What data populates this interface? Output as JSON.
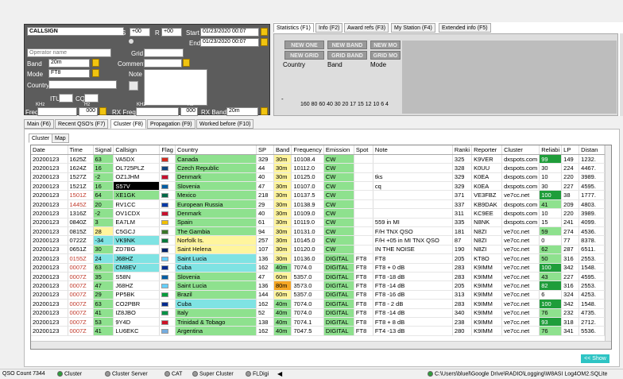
{
  "entry": {
    "callsign": "CALLSIGN",
    "s_label": "S",
    "s_value": "+00",
    "r_label": "R",
    "r_value": "+00",
    "start_label": "Start",
    "start_value": "01/23/2020 00:07",
    "end_label": "End",
    "end_value": "01/23/2020 00:07",
    "operator_placeholder": "Operator name",
    "grid_label": "Grid",
    "band_label": "Band",
    "band_value": "20m",
    "comment_label": "Comment",
    "mode_label": "Mode",
    "mode_value": "FT8",
    "note_label": "Note",
    "country_label": "Country",
    "itu_label": "ITU",
    "cq_label": "CQ",
    "freq_label": "Freq",
    "khz": "KHz",
    "hz": "Hz",
    "freq_value": "000",
    "rxfreq_label": "RX Freq",
    "rxfreq_value": "000",
    "rxband_label": "RX Band",
    "rxband_value": "20m"
  },
  "stats": {
    "tabs": [
      "Statistics (F1)",
      "Info (F2)",
      "Award refs (F3)",
      "My Station (F4)",
      "Extended info (F5)"
    ],
    "buttons": [
      "NEW ONE",
      "NEW BAND",
      "NEW MO",
      "NEW GRID",
      "GRID BAND",
      "GRID MO"
    ],
    "labels": [
      "Country",
      "Band",
      "Mode"
    ],
    "axis": "160 80 60 40 30 20 17 15 12 10 6 4",
    "dash": "-"
  },
  "main_tabs": [
    "Main (F6)",
    "Recent QSO's (F7)",
    "Cluster (F8)",
    "Propagation (F9)",
    "Worked before (F10)"
  ],
  "sub_tabs": [
    "Cluster",
    "Map"
  ],
  "columns": [
    "Date",
    "Time",
    "Signal",
    "Callsign",
    "Flag",
    "Country",
    "SP",
    "Band",
    "Frequency",
    "Emission",
    "Spot",
    "Note",
    "Ranki",
    "Reporter",
    "Cluster",
    "Reliabi",
    "LP",
    "Distan"
  ],
  "rows": [
    [
      "20200123",
      "1625Z",
      "63",
      "VA5DX",
      "ca",
      "Canada",
      "329",
      "30m",
      "10108.4",
      "CW",
      "",
      "",
      "325",
      "K9VER",
      "dxspots.com",
      "99",
      "149",
      "1232."
    ],
    [
      "20200123",
      "1624Z",
      "16",
      "OL725PLZ",
      "cz",
      "Czech Republic",
      "44",
      "30m",
      "10112.0",
      "CW",
      "",
      "",
      "328",
      "K0UU",
      "dxspots.com",
      "30",
      "224",
      "4467."
    ],
    [
      "20200123",
      "1527Z",
      "-2",
      "OZ1JHM",
      "dk",
      "Denmark",
      "40",
      "30m",
      "10125.0",
      "CW",
      "",
      "tks",
      "329",
      "K0EA",
      "dxspots.com",
      "10",
      "220",
      "3989."
    ],
    [
      "20200123",
      "1521Z",
      "16",
      "S57V",
      "si",
      "Slovenia",
      "47",
      "30m",
      "10107.0",
      "CW",
      "",
      "cq",
      "329",
      "K0EA",
      "dxspots.com",
      "30",
      "227",
      "4595."
    ],
    [
      "20200123",
      "1501Z",
      "64",
      "XE1GK",
      "mx",
      "Mexico",
      "218",
      "30m",
      "10137.5",
      "CW",
      "",
      "",
      "371",
      "VE3FBZ",
      "ve7cc.net",
      "100",
      "38",
      "1777."
    ],
    [
      "20200123",
      "1445Z",
      "20",
      "RV1CC",
      "ru",
      "European Russia",
      "29",
      "30m",
      "10138.9",
      "CW",
      "",
      "",
      "337",
      "KB9DAK",
      "dxspots.com",
      "41",
      "209",
      "4803."
    ],
    [
      "20200123",
      "1316Z",
      "-2",
      "OV1CDX",
      "dk",
      "Denmark",
      "40",
      "30m",
      "10109.0",
      "CW",
      "",
      "",
      "311",
      "KC9EE",
      "dxspots.com",
      "10",
      "220",
      "3989."
    ],
    [
      "20200123",
      "0840Z",
      "3",
      "EA7LM",
      "es",
      "Spain",
      "61",
      "30m",
      "10119.0",
      "CW",
      "",
      "559 in MI",
      "335",
      "N8NK",
      "dxspots.com",
      "15",
      "241",
      "4099."
    ],
    [
      "20200123",
      "0815Z",
      "28",
      "C5GCJ",
      "gm",
      "The Gambia",
      "94",
      "30m",
      "10131.0",
      "CW",
      "",
      "F/H TNX QSO",
      "181",
      "N8ZI",
      "ve7cc.net",
      "59",
      "274",
      "4536."
    ],
    [
      "20200123",
      "0722Z",
      "-34",
      "VK9NK",
      "nf",
      "Norfolk Is.",
      "257",
      "30m",
      "10145.0",
      "CW",
      "",
      "F/H +05 in MI TNX QSO",
      "87",
      "N8ZI",
      "ve7cc.net",
      "0",
      "77",
      "8378."
    ],
    [
      "20200123",
      "0651Z",
      "30",
      "ZD7BG",
      "sh",
      "Saint Helena",
      "107",
      "30m",
      "10120.0",
      "CW",
      "",
      "IN THE NOISE",
      "190",
      "N8ZI",
      "ve7cc.net",
      "62",
      "287",
      "6511."
    ],
    [
      "20200123",
      "0155Z",
      "24",
      "J68HZ",
      "lc",
      "Saint Lucia",
      "136",
      "30m",
      "10136.0",
      "DIGITAL",
      "FT8",
      "FT8",
      "205",
      "KT8O",
      "ve7cc.net",
      "50",
      "316",
      "2553."
    ],
    [
      "20200123",
      "0007Z",
      "63",
      "CM8EV",
      "cu",
      "Cuba",
      "162",
      "40m",
      "7074.0",
      "DIGITAL",
      "FT8",
      "FT8 + 0 dB",
      "283",
      "K9IMM",
      "ve7cc.net",
      "100",
      "342",
      "1548."
    ],
    [
      "20200123",
      "0007Z",
      "35",
      "S58N",
      "si",
      "Slovenia",
      "47",
      "60m",
      "5357.0",
      "DIGITAL",
      "FT8",
      "FT8 -18 dB",
      "283",
      "K9IMM",
      "ve7cc.net",
      "43",
      "227",
      "4595."
    ],
    [
      "20200123",
      "0007Z",
      "47",
      "J68HZ",
      "lc",
      "Saint Lucia",
      "136",
      "80m",
      "3573.0",
      "DIGITAL",
      "FT8",
      "FT8 -14 dB",
      "205",
      "K9IMM",
      "ve7cc.net",
      "82",
      "316",
      "2553."
    ],
    [
      "20200123",
      "0007Z",
      "29",
      "PP5BK",
      "br",
      "Brazil",
      "144",
      "60m",
      "5357.0",
      "DIGITAL",
      "FT8",
      "FT8 -16 dB",
      "313",
      "K9IMM",
      "ve7cc.net",
      "6",
      "324",
      "4253."
    ],
    [
      "20200123",
      "0007Z",
      "63",
      "CO2PBR",
      "cu",
      "Cuba",
      "162",
      "40m",
      "7074.0",
      "DIGITAL",
      "FT8",
      "FT8 - 2 dB",
      "283",
      "K9IMM",
      "ve7cc.net",
      "100",
      "342",
      "1548."
    ],
    [
      "20200123",
      "0007Z",
      "41",
      "IZ8JBO",
      "it",
      "Italy",
      "52",
      "40m",
      "7074.0",
      "DIGITAL",
      "FT8",
      "FT8 -14 dB",
      "340",
      "K9IMM",
      "ve7cc.net",
      "76",
      "232",
      "4735."
    ],
    [
      "20200123",
      "0007Z",
      "53",
      "9Y4D",
      "tt",
      "Trinidad & Tobago",
      "138",
      "40m",
      "7074.1",
      "DIGITAL",
      "FT8",
      "FT8 + 8 dB",
      "238",
      "K9IMM",
      "ve7cc.net",
      "93",
      "318",
      "2712."
    ],
    [
      "20200123",
      "0007Z",
      "41",
      "LU6EKC",
      "ar",
      "Argentina",
      "162",
      "40m",
      "7047.5",
      "DIGITAL",
      "FT8",
      "FT4 -13 dB",
      "280",
      "K9IMM",
      "ve7cc.net",
      "76",
      "341",
      "5536."
    ]
  ],
  "show_button": "<< Show",
  "status": {
    "qso_count": "QSO Count  7344",
    "items": [
      "Cluster",
      "Cluster Server",
      "CAT",
      "Super Cluster",
      "FLDigi"
    ],
    "path": "C:\\Users\\bluel\\Google Drive\\RADIO\\Logging\\W8ASI Log4OM2.SQLite"
  },
  "colors": {
    "country_bg": "#8ee18e",
    "time_red": "#c0392b",
    "reliab_high": "#1f9d3a"
  }
}
